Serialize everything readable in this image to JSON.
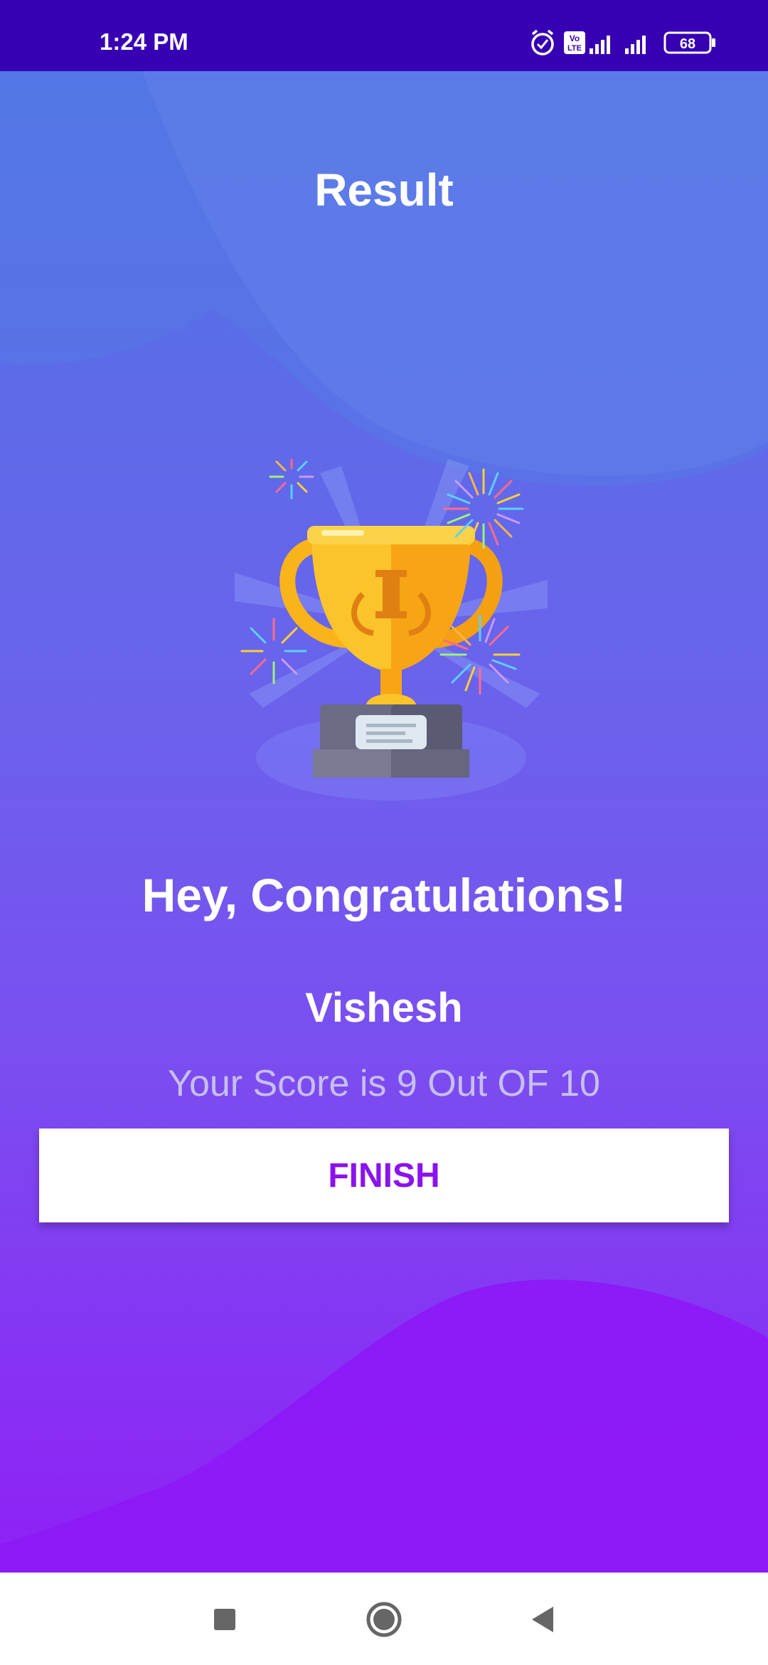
{
  "status_bar": {
    "time": "1:24 PM",
    "volte_label": "Vo LTE",
    "battery_level": "68",
    "icons": [
      "alarm-icon",
      "volte-icon",
      "signal-icon",
      "signal-icon",
      "battery-icon"
    ]
  },
  "screen": {
    "title": "Result",
    "trophy_icon": "trophy-icon",
    "congrats_text": "Hey, Congratulations!",
    "user_name": "Vishesh",
    "score_text": "Your Score is 9 Out OF 10",
    "finish_label": "FINISH"
  },
  "nav_bar": {
    "icons": [
      "recents-icon",
      "home-icon",
      "back-icon"
    ]
  },
  "colors": {
    "status_bar": "#3700b3",
    "gradient_top": "#4f74e4",
    "gradient_bottom": "#8f20f6",
    "finish_text": "#8b12ee",
    "score_text": "#c7bfee"
  }
}
